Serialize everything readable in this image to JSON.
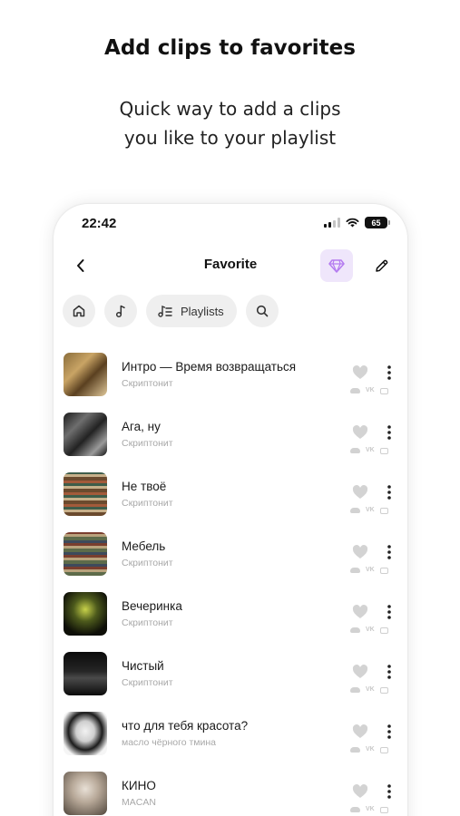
{
  "promo": {
    "title": "Add clips to favorites",
    "subtitle_line1": "Quick way to add a clips",
    "subtitle_line2": "you like to your playlist"
  },
  "status_bar": {
    "time": "22:42",
    "battery": "65"
  },
  "header": {
    "title": "Favorite",
    "back_icon": "chevron-left-icon",
    "premium_icon": "diamond-icon",
    "edit_icon": "pencil-icon"
  },
  "filters": {
    "home_icon": "home-icon",
    "music_icon": "music-note-icon",
    "playlists_label": "Playlists",
    "playlists_icon": "playlist-icon",
    "search_icon": "search-icon"
  },
  "colors": {
    "accent": "#b57cf0",
    "accent_bg": "#efe6fb",
    "chip_bg": "#efefef",
    "secondary_text": "#a8a8a8"
  },
  "tracks": [
    {
      "title": "Интро — Время возвращаться",
      "artist": "Скриптонит"
    },
    {
      "title": "Ага, ну",
      "artist": "Скриптонит"
    },
    {
      "title": "Не твоё",
      "artist": "Скриптонит"
    },
    {
      "title": "Мебель",
      "artist": "Скриптонит"
    },
    {
      "title": "Вечеринка",
      "artist": "Скриптонит"
    },
    {
      "title": "Чистый",
      "artist": "Скриптонит"
    },
    {
      "title": "что для тебя красота?",
      "artist": "масло чёрного тмина"
    },
    {
      "title": "КИНО",
      "artist": "MACAN"
    }
  ],
  "source_labels": {
    "vk": "VK"
  }
}
